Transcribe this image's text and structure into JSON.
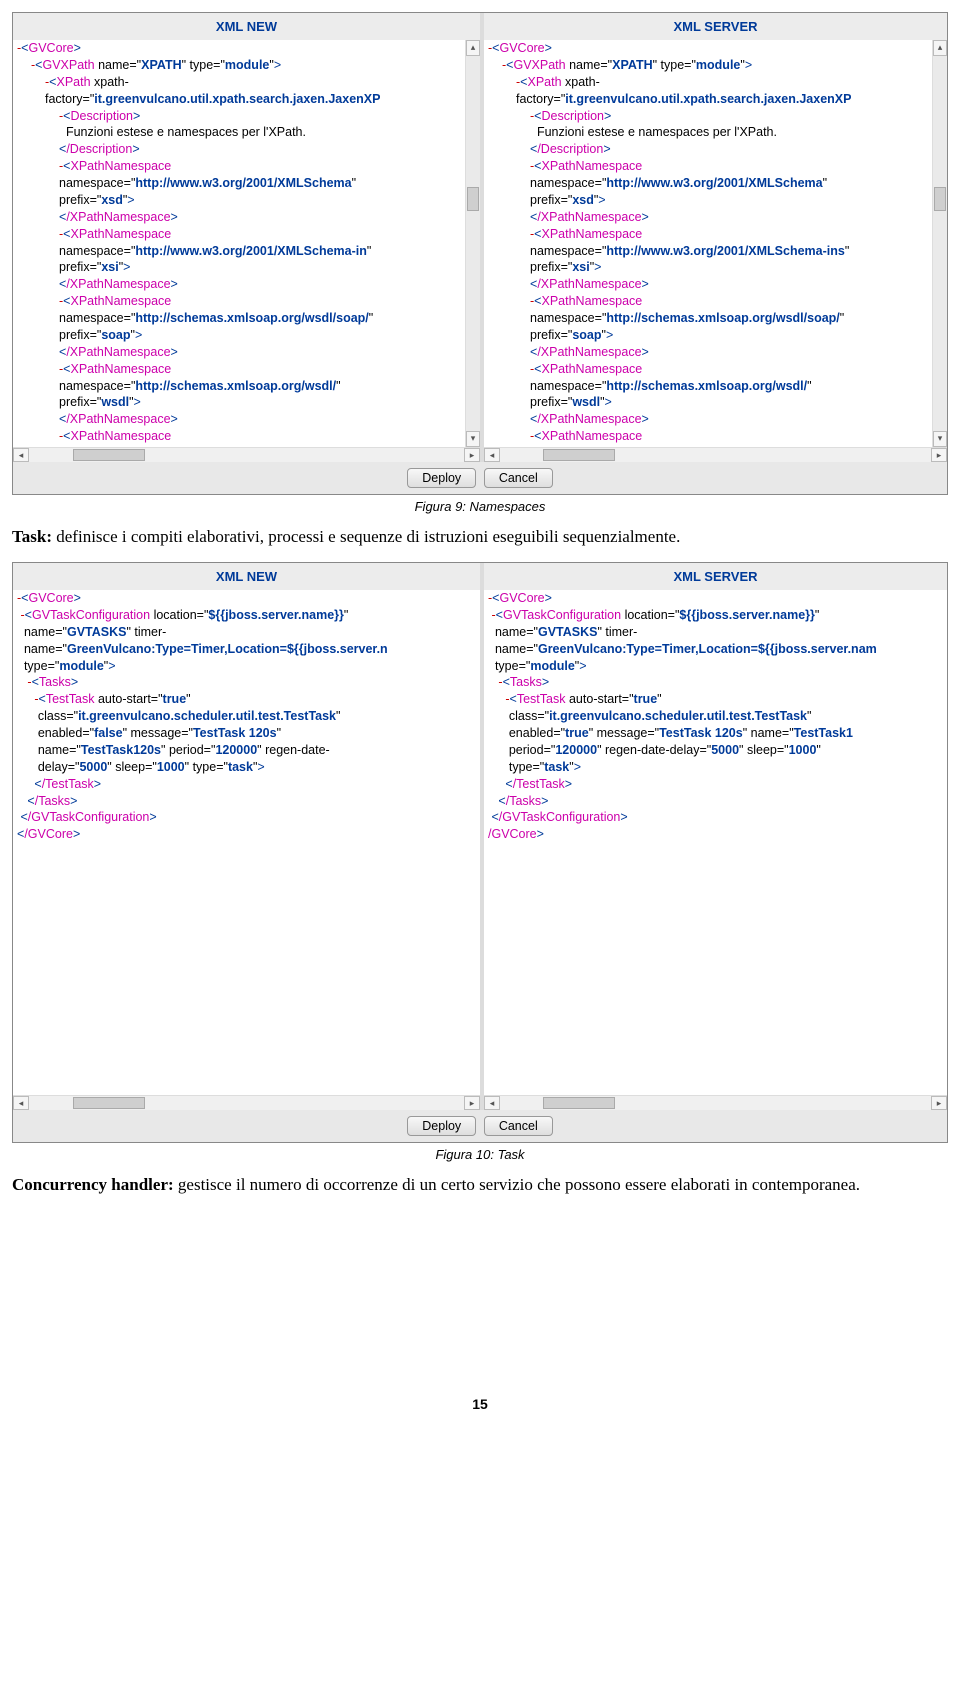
{
  "headers": {
    "new": "XML NEW",
    "server": "XML SERVER"
  },
  "buttons": {
    "deploy": "Deploy",
    "cancel": "Cancel"
  },
  "captions": {
    "fig9": "Figura 9: Namespaces",
    "fig10": "Figura 10: Task"
  },
  "para": {
    "task_b": "Task:",
    "task": " definisce i compiti elaborativi, processi e sequenze di istruzioni eseguibili sequenzialmente.",
    "conc_b": "Concurrency handler:",
    "conc": " gestisce il numero di occorrenze di un certo servizio che possono essere elaborati in contemporanea."
  },
  "page": "15",
  "panel1": {
    "gvcore": "GVCore",
    "l1": {
      "d": "-",
      "t": "GVXPath",
      "a": [
        [
          "name",
          "XPATH"
        ],
        [
          "type",
          "module"
        ]
      ]
    },
    "l2": {
      "d": "-",
      "t": "XPath",
      "a_pre": "xpath-",
      "a_key": "factory",
      "a_val": "it.greenvulcano.util.xpath.search.jaxen.JaxenXP"
    },
    "l3": {
      "d": "-",
      "t": "Description"
    },
    "l4": "Funzioni estese e namespaces per l'XPath.",
    "l5": {
      "t": "/Description"
    },
    "ns": [
      {
        "namespace": "http://www.w3.org/2001/XMLSchema",
        "prefix": "xsd"
      },
      {
        "namespace": "http://www.w3.org/2001/XMLSchema-in",
        "server_namespace": "http://www.w3.org/2001/XMLSchema-ins",
        "prefix": "xsi"
      },
      {
        "namespace": "http://schemas.xmlsoap.org/wsdl/soap/",
        "prefix": "soap"
      },
      {
        "namespace": "http://schemas.xmlsoap.org/wsdl/",
        "prefix": "wsdl"
      }
    ]
  },
  "panel2": {
    "new": {
      "gvcore": "GVCore",
      "cfg": {
        "t": "GVTaskConfiguration",
        "loc": "${{jboss.server.name}}",
        "name": "GVTASKS",
        "timer_pre": "timer-",
        "timer_key": "name",
        "timer_val": "GreenVulcano:Type=Timer,Location=${{jboss.server.n",
        "type": "module"
      },
      "tasks": "Tasks",
      "tt": {
        "t": "TestTask",
        "auto": "true",
        "class": "it.greenvulcano.scheduler.util.test.TestTask",
        "enabled": "false",
        "message": "TestTask 120s",
        "name": "TestTask120s",
        "period": "120000",
        "regen_key": "regen-date-delay",
        "regen_val": "5000",
        "sleep": "1000",
        "type": "task"
      }
    },
    "server": {
      "gvcore": "GVCore",
      "cfg": {
        "t": "GVTaskConfiguration",
        "loc": "${{jboss.server.name}}",
        "name": "GVTASKS",
        "timer_pre": "timer-",
        "timer_key": "name",
        "timer_val": "GreenVulcano:Type=Timer,Location=${{jboss.server.nam",
        "type": "module"
      },
      "tasks": "Tasks",
      "tt": {
        "t": "TestTask",
        "auto": "true",
        "class": "it.greenvulcano.scheduler.util.test.TestTask",
        "enabled": "true",
        "message": "TestTask 120s",
        "name": "TestTask1",
        "period": "120000",
        "regen_key": "regen-date-delay",
        "regen_val": "5000",
        "sleep": "1000",
        "type": "task"
      },
      "close": "/GVCore"
    }
  }
}
